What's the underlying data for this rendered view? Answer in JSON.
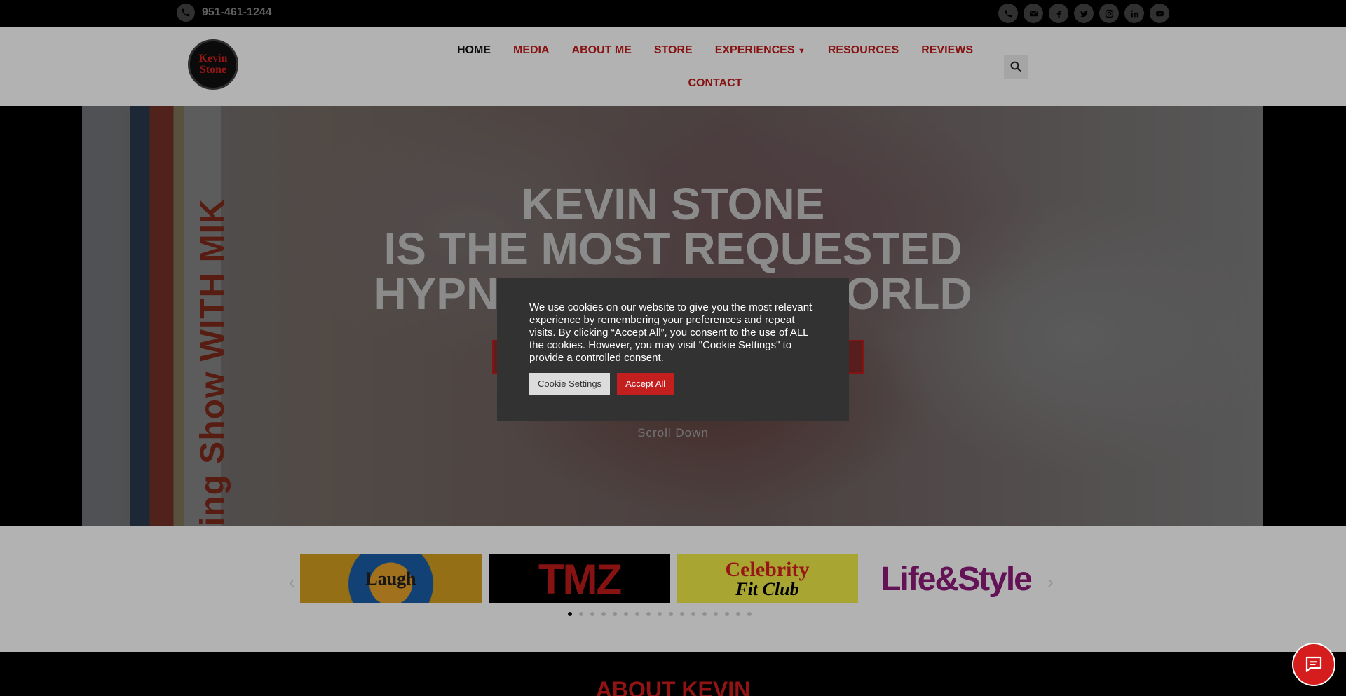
{
  "topbar": {
    "phone": "951-461-1244",
    "socials": [
      "phone-icon",
      "envelope-icon",
      "facebook-icon",
      "twitter-icon",
      "instagram-icon",
      "linkedin-icon",
      "youtube-icon"
    ]
  },
  "header": {
    "logo_line1": "Kevin",
    "logo_line2": "Stone",
    "nav": {
      "home": "HOME",
      "media": "MEDIA",
      "about": "ABOUT ME",
      "store": "STORE",
      "experiences": "EXPERIENCES",
      "resources": "RESOURCES",
      "reviews": "REVIEWS",
      "contact": "CONTACT"
    }
  },
  "hero": {
    "line1": "KEVIN STONE",
    "line2": "IS THE MOST REQUESTED",
    "line3": "HYPNOTIST IN THE WORLD",
    "strip_text": "ing Show WITH MIK",
    "scroll_down": "Scroll Down"
  },
  "press": {
    "laugh": "Laugh",
    "tmz": "TMZ",
    "celebrity": "Celebrity",
    "fitclub": "Fit Club",
    "lifestyle": "Life&Style",
    "dots_total": 17,
    "dots_active_index": 0
  },
  "about": {
    "title": "ABOUT KEVIN"
  },
  "cookie": {
    "text": "We use cookies on our website to give you the most relevant experience by remembering your preferences and repeat visits. By clicking “Accept All”, you consent to the use of ALL the cookies. However, you may visit \"Cookie Settings\" to provide a controlled consent.",
    "settings_label": "Cookie Settings",
    "accept_label": "Accept All"
  },
  "colors": {
    "brand_red": "#c11a1a",
    "topbar_bg": "#000000",
    "modal_bg": "#323232"
  }
}
